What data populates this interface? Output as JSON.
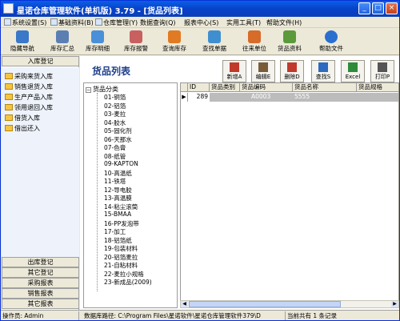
{
  "window": {
    "title": "星诺仓库管理软件(单机版) 3.79 - [货品列表]",
    "min": "_",
    "max": "□",
    "close": "×"
  },
  "menu": [
    "系统设置(S)",
    "基础资料(B)",
    "仓库管理(Y)",
    "数据查询(Q)",
    "报表中心(S)",
    "实用工具(T)",
    "帮助文件(H)"
  ],
  "toolbar": [
    {
      "label": "隐藏导航",
      "icon": "navigation-icon",
      "color": "#3a78c9"
    },
    {
      "label": "库存汇总",
      "icon": "inventory-summary-icon",
      "color": "#5b7fb3"
    },
    {
      "label": "库存明细",
      "icon": "inventory-detail-icon",
      "color": "#4a90d9"
    },
    {
      "label": "库存报警",
      "icon": "inventory-alarm-icon",
      "color": "#c86060"
    },
    {
      "label": "查询库存",
      "icon": "query-inventory-icon",
      "color": "#e07b24"
    },
    {
      "label": "查找单据",
      "icon": "find-document-icon",
      "color": "#3f8fd0"
    },
    {
      "label": "往来单位",
      "icon": "business-units-icon",
      "color": "#d76b2a"
    },
    {
      "label": "货品资料",
      "icon": "goods-info-icon",
      "color": "#5a9a3a"
    },
    {
      "label": "帮助文件",
      "icon": "help-icon",
      "color": "#2a6fd0"
    }
  ],
  "left": {
    "header": "入库登记",
    "items": [
      "采购来货入库",
      "销售退货入库",
      "生产产品入库",
      "领用退回入库",
      "借货入库",
      "借出还入"
    ],
    "bottom": [
      "出库登记",
      "其它登记",
      "采购报表",
      "销售报表",
      "其它报表"
    ]
  },
  "main": {
    "title": "货品列表",
    "actions": [
      {
        "label": "新增A",
        "icon": "add-icon",
        "color": "#c0392b"
      },
      {
        "label": "编辑E",
        "icon": "edit-icon",
        "color": "#7a5c3a"
      },
      {
        "label": "删除D",
        "icon": "delete-icon",
        "color": "#c0392b"
      },
      {
        "label": "查找S",
        "icon": "find-icon",
        "color": "#2c6bbf"
      },
      {
        "label": "Excel",
        "icon": "excel-icon",
        "color": "#2e8b3a"
      },
      {
        "label": "打印P",
        "icon": "print-icon",
        "color": "#555555"
      }
    ]
  },
  "tree": {
    "root": "货品分类",
    "items": [
      "01-铜箔",
      "02-铝箔",
      "03-麦拉",
      "04-胶水",
      "05-固化剂",
      "06-天那水",
      "07-色膏",
      "08-纸管",
      "09-KAPTON",
      "10-高温纸",
      "11-铁塔",
      "12-导电胶",
      "13-高温膜",
      "14-粘尘滚筒",
      "15-BMAA",
      "16-PP发泡带",
      "17-加工",
      "18-铝箔纸",
      "19-包装材料",
      "20-铝箔麦拉",
      "21-自粘材料",
      "22-麦拉小规格",
      "23-新成品(2009)"
    ]
  },
  "grid": {
    "columns": [
      "ID",
      "货品类别",
      "货品编码",
      "货品名称",
      "货品规格"
    ],
    "row": {
      "id": "289",
      "category": "",
      "code": "A0003",
      "name": "5555",
      "spec": ""
    }
  },
  "status": {
    "operator_label": "操作员:",
    "operator": "Admin",
    "path_label": "数据库路径:",
    "path": "C:\\Program Files\\星诺软件\\星诺仓库管理软件379\\D",
    "count": "当前共有 1 条记录"
  }
}
